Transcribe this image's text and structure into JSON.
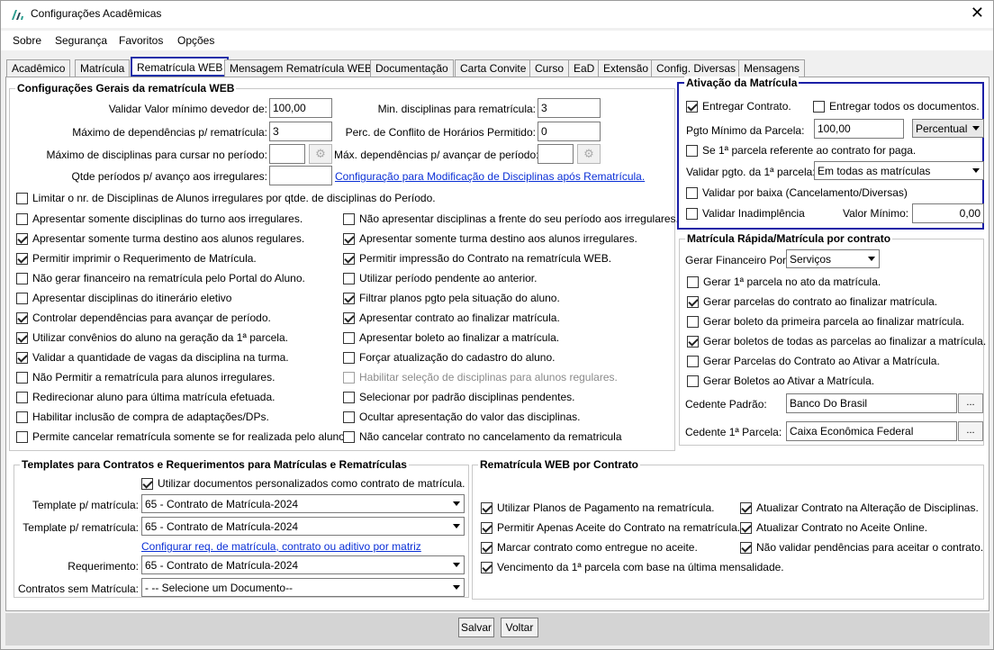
{
  "window": {
    "title": "Configurações Acadêmicas",
    "close": "✕"
  },
  "menu": [
    "Sobre",
    "Segurança",
    "Favoritos",
    "Opções"
  ],
  "tabs": [
    "Acadêmico",
    "Matrícula",
    "Rematrícula WEB",
    "Mensagem Rematrícula WEB",
    "Documentação",
    "Carta Convite",
    "Curso",
    "EaD",
    "Extensão",
    "Config. Diversas",
    "Mensagens"
  ],
  "geral": {
    "legend": "Configurações Gerais da rematrícula WEB",
    "valor_minimo_label": "Validar Valor mínimo devedor de:",
    "valor_minimo": "100,00",
    "max_dep_label": "Máximo de dependências p/ rematrícula:",
    "max_dep": "3",
    "max_disc_label": "Máximo de disciplinas para cursar no período:",
    "max_disc": "",
    "qtde_periodos_label": "Qtde períodos p/ avanço aos irregulares:",
    "qtde_periodos": "",
    "min_disc_label": "Min. disciplinas para rematrícula:",
    "min_disc": "3",
    "perc_conflito_label": "Perc. de Conflito de Horários Permitido:",
    "perc_conflito": "0",
    "max_dep_avancar_label": "Máx. dependências p/ avançar de período:",
    "max_dep_avancar": "",
    "config_link": "Configuração para Modificação de Disciplinas após Rematrícula.",
    "limitar": "Limitar o nr. de Disciplinas de Alunos irregulares por qtde. de disciplinas do Período.",
    "left": [
      {
        "label": "Apresentar somente disciplinas do turno aos irregulares.",
        "checked": false
      },
      {
        "label": "Apresentar somente turma destino aos alunos regulares.",
        "checked": true
      },
      {
        "label": "Permitir imprimir o Requerimento de Matrícula.",
        "checked": true
      },
      {
        "label": "Não gerar financeiro na rematrícula pelo Portal do Aluno.",
        "checked": false
      },
      {
        "label": "Apresentar disciplinas do itinerário eletivo",
        "checked": false
      },
      {
        "label": "Controlar dependências para avançar de período.",
        "checked": true
      },
      {
        "label": "Utilizar convênios do aluno na geração da 1ª parcela.",
        "checked": true
      },
      {
        "label": "Validar a quantidade de vagas da disciplina na turma.",
        "checked": true
      },
      {
        "label": "Não Permitir a rematrícula para alunos irregulares.",
        "checked": false
      },
      {
        "label": "Redirecionar aluno para última matrícula efetuada.",
        "checked": false
      },
      {
        "label": "Habilitar inclusão de compra de adaptações/DPs.",
        "checked": false
      },
      {
        "label": "Permite cancelar rematrícula somente se for realizada pelo aluno.",
        "checked": false
      }
    ],
    "right": [
      {
        "label": "Não apresentar disciplinas a frente do seu período aos irregulares.",
        "checked": false
      },
      {
        "label": "Apresentar somente turma destino aos alunos irregulares.",
        "checked": true
      },
      {
        "label": "Permitir impressão do Contrato na rematrícula WEB.",
        "checked": true
      },
      {
        "label": "Utilizar período pendente ao anterior.",
        "checked": false
      },
      {
        "label": "Filtrar planos pgto pela situação do aluno.",
        "checked": true
      },
      {
        "label": "Apresentar contrato ao finalizar matrícula.",
        "checked": true
      },
      {
        "label": "Apresentar boleto ao finalizar a matrícula.",
        "checked": false
      },
      {
        "label": "Forçar atualização do cadastro do aluno.",
        "checked": false
      },
      {
        "label": "Habilitar seleção de disciplinas para alunos regulares.",
        "checked": false,
        "disabled": true
      },
      {
        "label": "Selecionar por padrão disciplinas pendentes.",
        "checked": false
      },
      {
        "label": "Ocultar apresentação do valor das disciplinas.",
        "checked": false
      },
      {
        "label": "Não cancelar contrato no cancelamento da rematricula",
        "checked": false
      }
    ]
  },
  "ativacao": {
    "legend": "Ativação da Matrícula",
    "entregar_contrato": "Entregar Contrato.",
    "entregar_todos": "Entregar todos os documentos.",
    "pgto_minimo_label": "Pgto Mínimo da Parcela:",
    "pgto_minimo": "100,00",
    "pgto_tipo": "Percentual",
    "se_primeira": "Se 1ª parcela referente ao contrato for paga.",
    "validar_pgto_label": "Validar pgto. da 1ª parcela:",
    "validar_pgto": "Em todas as matrículas",
    "validar_baixa": "Validar por baixa (Cancelamento/Diversas)",
    "validar_inad": "Validar Inadimplência",
    "valor_minimo_label": "Valor Mínimo:",
    "valor_minimo": "0,00"
  },
  "rapida": {
    "legend": "Matrícula Rápida/Matrícula por contrato",
    "gerar_fin_label": "Gerar Financeiro Por:",
    "gerar_fin": "Serviços",
    "items": [
      {
        "label": "Gerar 1ª parcela no ato da matrícula.",
        "checked": false
      },
      {
        "label": "Gerar parcelas do contrato ao finalizar matrícula.",
        "checked": true
      },
      {
        "label": "Gerar boleto da primeira parcela ao finalizar matrícula.",
        "checked": false
      },
      {
        "label": "Gerar boletos de todas as parcelas ao finalizar a matrícula.",
        "checked": true
      },
      {
        "label": "Gerar Parcelas do Contrato ao Ativar a Matrícula.",
        "checked": false
      },
      {
        "label": "Gerar Boletos ao Ativar a Matrícula.",
        "checked": false
      }
    ],
    "cedente_label": "Cedente Padrão:",
    "cedente": "Banco Do Brasil",
    "cedente1_label": "Cedente 1ª Parcela:",
    "cedente1": "Caixa Econômica Federal",
    "dots": "..."
  },
  "templates": {
    "legend": "Templates para Contratos e Requerimentos para Matrículas e Rematrículas",
    "utilizar": "Utilizar documentos personalizados como contrato de matrícula.",
    "tpl_mat_label": "Template p/ matrícula:",
    "tpl_mat": "65 - Contrato de Matrícula-2024",
    "tpl_remat_label": "Template p/ rematrícula:",
    "tpl_remat": "65 - Contrato de Matrícula-2024",
    "config_link": "Configurar req. de matrícula, contrato ou aditivo por matriz",
    "req_label": "Requerimento:",
    "req": "65 - Contrato de Matrícula-2024",
    "sem_label": "Contratos sem Matrícula:",
    "sem": "- -- Selecione um Documento--"
  },
  "webcontrato": {
    "legend": "Rematrícula WEB por Contrato",
    "left": [
      {
        "label": "Utilizar Planos de Pagamento na rematrícula.",
        "checked": true
      },
      {
        "label": "Permitir Apenas Aceite do Contrato na rematrícula.",
        "checked": true
      },
      {
        "label": "Marcar contrato como entregue no aceite.",
        "checked": true
      },
      {
        "label": "Vencimento da 1ª parcela com base na última mensalidade.",
        "checked": true
      }
    ],
    "right": [
      {
        "label": "Atualizar Contrato na Alteração de Disciplinas.",
        "checked": true
      },
      {
        "label": "Atualizar Contrato no Aceite Online.",
        "checked": true
      },
      {
        "label": "Não validar pendências para aceitar o contrato.",
        "checked": true
      }
    ]
  },
  "buttons": {
    "salvar": "Salvar",
    "voltar": "Voltar"
  }
}
